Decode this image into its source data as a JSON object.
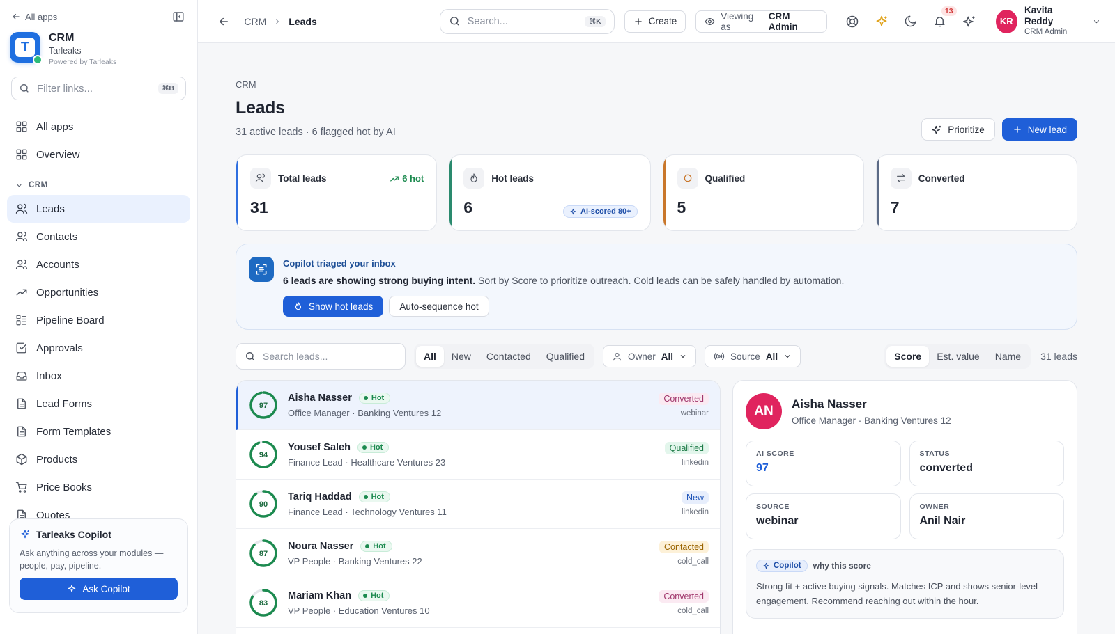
{
  "sidebar": {
    "back_label": "All apps",
    "brand": {
      "name": "CRM",
      "org": "Tarleaks",
      "powered": "Powered by Tarleaks",
      "logo_letter": "T"
    },
    "filter": {
      "placeholder": "Filter links...",
      "shortcut": "⌘B"
    },
    "top_items": [
      {
        "label": "All apps",
        "icon": "grid-icon"
      },
      {
        "label": "Overview",
        "icon": "grid-icon"
      }
    ],
    "section_label": "CRM",
    "items": [
      {
        "label": "Leads",
        "icon": "users-icon",
        "active": true
      },
      {
        "label": "Contacts",
        "icon": "users-icon"
      },
      {
        "label": "Accounts",
        "icon": "users-icon"
      },
      {
        "label": "Opportunities",
        "icon": "trending-up-icon"
      },
      {
        "label": "Pipeline Board",
        "icon": "kanban-icon"
      },
      {
        "label": "Approvals",
        "icon": "check-square-icon"
      },
      {
        "label": "Inbox",
        "icon": "inbox-icon"
      },
      {
        "label": "Lead Forms",
        "icon": "document-icon"
      },
      {
        "label": "Form Templates",
        "icon": "document-icon"
      },
      {
        "label": "Products",
        "icon": "box-icon"
      },
      {
        "label": "Price Books",
        "icon": "cart-icon"
      },
      {
        "label": "Quotes",
        "icon": "document-icon"
      }
    ],
    "copilot": {
      "title": "Tarleaks Copilot",
      "text": "Ask anything across your modules — people, pay, pipeline.",
      "button": "Ask Copilot"
    }
  },
  "topbar": {
    "crumbs": [
      "CRM",
      "Leads"
    ],
    "search_placeholder": "Search...",
    "search_shortcut": "⌘K",
    "create_label": "Create",
    "viewing_prefix": "Viewing as",
    "viewing_role": "CRM Admin",
    "notifications_count": "13",
    "user": {
      "initials": "KR",
      "name": "Kavita Reddy",
      "role": "CRM Admin"
    }
  },
  "page": {
    "crumb": "CRM",
    "title": "Leads",
    "subtitle": "31 active leads · 6 flagged hot by AI",
    "prioritize_label": "Prioritize",
    "new_lead_label": "New lead"
  },
  "stats": [
    {
      "label": "Total leads",
      "value": "31",
      "trend": "6 hot",
      "accent": "#2f6fe0"
    },
    {
      "label": "Hot leads",
      "value": "6",
      "pill": "AI-scored 80+",
      "accent": "#2a8a6e"
    },
    {
      "label": "Qualified",
      "value": "5",
      "accent": "#c9772b"
    },
    {
      "label": "Converted",
      "value": "7",
      "accent": "#5c6b86"
    }
  ],
  "triage": {
    "title": "Copilot triaged your inbox",
    "text_bold": "6 leads are showing strong buying intent.",
    "text_rest": " Sort by Score to prioritize outreach. Cold leads can be safely handled by automation.",
    "primary_btn": "Show hot leads",
    "secondary_btn": "Auto-sequence hot"
  },
  "filters": {
    "search_placeholder": "Search leads...",
    "status_tabs": [
      "All",
      "New",
      "Contacted",
      "Qualified"
    ],
    "status_selected": "All",
    "owner_label": "Owner",
    "owner_value": "All",
    "source_label": "Source",
    "source_value": "All",
    "sort_tabs": [
      "Score",
      "Est. value",
      "Name"
    ],
    "sort_selected": "Score",
    "count": "31 leads"
  },
  "leads": [
    {
      "score": 97,
      "name": "Aisha Nasser",
      "tag": "Hot",
      "sub": "Office Manager · Banking Ventures 12",
      "status": "Converted",
      "status_key": "converted",
      "source": "webinar",
      "selected": true
    },
    {
      "score": 94,
      "name": "Yousef Saleh",
      "tag": "Hot",
      "sub": "Finance Lead · Healthcare Ventures 23",
      "status": "Qualified",
      "status_key": "qualified",
      "source": "linkedin"
    },
    {
      "score": 90,
      "name": "Tariq Haddad",
      "tag": "Hot",
      "sub": "Finance Lead · Technology Ventures 11",
      "status": "New",
      "status_key": "new",
      "source": "linkedin"
    },
    {
      "score": 87,
      "name": "Noura Nasser",
      "tag": "Hot",
      "sub": "VP People · Banking Ventures 22",
      "status": "Contacted",
      "status_key": "contacted",
      "source": "cold_call"
    },
    {
      "score": 83,
      "name": "Mariam Khan",
      "tag": "Hot",
      "sub": "VP People · Education Ventures 10",
      "status": "Converted",
      "status_key": "converted",
      "source": "cold_call"
    }
  ],
  "detail": {
    "initials": "AN",
    "name": "Aisha Nasser",
    "role": "Office Manager · Banking Ventures 12",
    "cells": [
      {
        "label": "AI SCORE",
        "value": "97",
        "blue": true
      },
      {
        "label": "STATUS",
        "value": "converted"
      },
      {
        "label": "SOURCE",
        "value": "webinar"
      },
      {
        "label": "OWNER",
        "value": "Anil Nair"
      }
    ],
    "why_pill": "Copilot",
    "why_title": "why this score",
    "why_text": "Strong fit + active buying signals. Matches ICP and shows senior-level engagement. Recommend reaching out within the hour."
  },
  "colors": {
    "primary": "#1f5fd8",
    "hot_green": "#1c8a4f",
    "avatar_pink": "#e0245e"
  }
}
